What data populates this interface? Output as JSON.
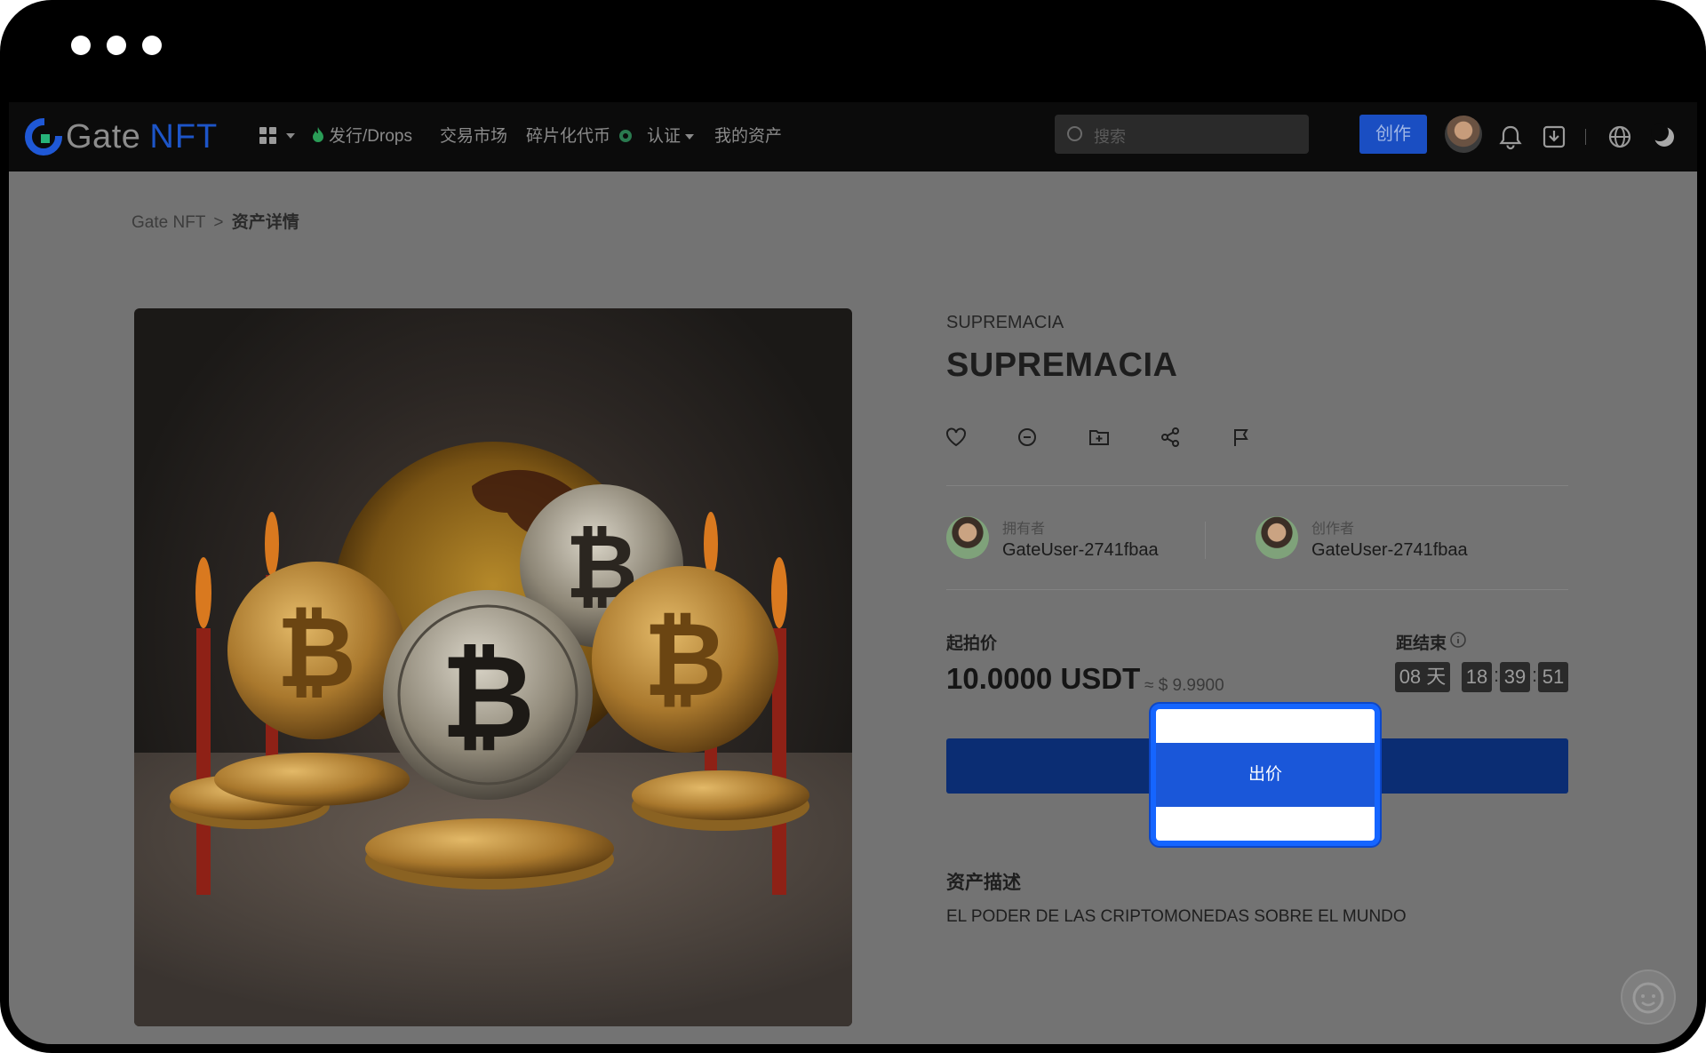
{
  "nav": {
    "logo_text": "Gate",
    "logo_nft": "NFT",
    "items": [
      {
        "label": "发行/Drops"
      },
      {
        "label": "交易市场"
      },
      {
        "label": "碎片化代币"
      },
      {
        "label": "认证"
      },
      {
        "label": "我的资产"
      }
    ],
    "search_placeholder": "搜索",
    "create_label": "创作"
  },
  "breadcrumb": {
    "root": "Gate NFT",
    "sep": ">",
    "current": "资产详情"
  },
  "asset": {
    "collection": "SUPREMACIA",
    "title": "SUPREMACIA",
    "owner_role": "拥有者",
    "owner_name": "GateUser-2741fbaa",
    "creator_role": "创作者",
    "creator_name": "GateUser-2741fbaa",
    "price_label": "起拍价",
    "price": "10.0000 USDT",
    "price_usd": "≈ $ 9.9900",
    "countdown_label": "距结束",
    "countdown": {
      "days": "08",
      "days_unit": "天",
      "hours": "18",
      "minutes": "39",
      "seconds": "51"
    },
    "bid_label": "出价",
    "description_title": "资产描述",
    "description": "EL PODER DE LAS CRIPTOMONEDAS SOBRE EL MUNDO"
  },
  "colors": {
    "accent": "#1a57d9",
    "highlight_border": "#1565ff",
    "brand_blue": "#1d55c8",
    "overlay": "#737373"
  }
}
